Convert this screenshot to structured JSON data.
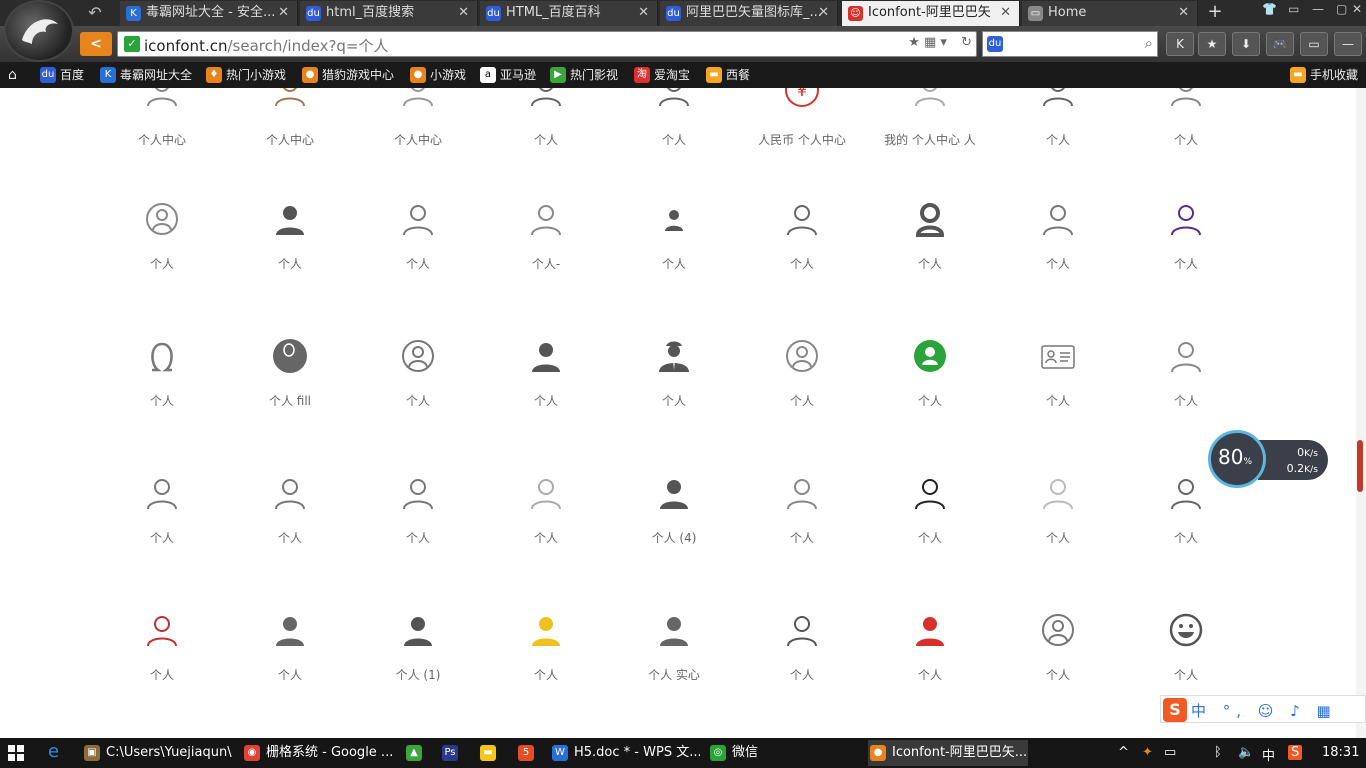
{
  "tabs": [
    {
      "title": "毒霸网址大全 - 安全...",
      "icon": "K",
      "color": "#2a6fd6"
    },
    {
      "title": "html_百度搜索",
      "icon": "du",
      "color": "#2f5ed8"
    },
    {
      "title": "HTML_百度百科",
      "icon": "du",
      "color": "#2f5ed8"
    },
    {
      "title": "阿里巴巴矢量图标库_...",
      "icon": "du",
      "color": "#2f5ed8"
    },
    {
      "title": "Iconfont-阿里巴巴矢",
      "icon": "☺",
      "color": "#d8312b"
    },
    {
      "title": "Home",
      "icon": "▭",
      "color": "#888"
    }
  ],
  "address": {
    "host": "iconfont.cn",
    "path": "/search/index?q=个人"
  },
  "bookmarks": [
    {
      "label": "百度",
      "color": "#2f5ed8",
      "icon": "du"
    },
    {
      "label": "毒霸网址大全",
      "color": "#2a6fd6",
      "icon": "K"
    },
    {
      "label": "热门小游戏",
      "color": "#e8841c",
      "icon": "♦"
    },
    {
      "label": "猎豹游戏中心",
      "color": "#e8841c",
      "icon": "●"
    },
    {
      "label": "小游戏",
      "color": "#e8841c",
      "icon": "●"
    },
    {
      "label": "亚马逊",
      "color": "#fff",
      "icon": "a"
    },
    {
      "label": "热门影视",
      "color": "#3aa63a",
      "icon": "▶"
    },
    {
      "label": "爱淘宝",
      "color": "#e03030",
      "icon": "淘"
    },
    {
      "label": "西餐",
      "color": "#f5a623",
      "icon": "▬"
    }
  ],
  "bookmarks_right": "手机收藏",
  "icon_rows": [
    [
      "个人中心",
      "个人中心",
      "个人中心",
      "个人",
      "个人",
      "人民币 个人中心",
      "我的 个人中心 人",
      "个人",
      "个人"
    ],
    [
      "个人",
      "个人",
      "个人",
      "个人-",
      "个人",
      "个人",
      "个人",
      "个人",
      "个人"
    ],
    [
      "个人",
      "个人 fill",
      "个人",
      "个人",
      "个人",
      "个人",
      "个人",
      "个人",
      "个人"
    ],
    [
      "个人",
      "个人",
      "个人",
      "个人",
      "个人 (4)",
      "个人",
      "个人",
      "个人",
      "个人"
    ],
    [
      "个人",
      "个人",
      "个人 (1)",
      "个人",
      "个人 实心",
      "个人",
      "个人",
      "个人",
      "个人"
    ]
  ],
  "net": {
    "percent": "80",
    "up": "0",
    "down": "0.2",
    "unit": "K/s"
  },
  "ime": "中 °, ☺ ♪ ▦",
  "taskbar": [
    {
      "label": "C:\\Users\\Yuejiaqun\\...",
      "color": "#8a6d3b",
      "icon": "▣"
    },
    {
      "label": "栅格系统 - Google ...",
      "color": "#db4437",
      "icon": "◉"
    },
    {
      "label": "",
      "color": "#3aa63a",
      "icon": "▲"
    },
    {
      "label": "",
      "color": "#2b3a8a",
      "icon": "Ps"
    },
    {
      "label": "",
      "color": "#f5c518",
      "icon": "▬"
    },
    {
      "label": "",
      "color": "#e44d26",
      "icon": "5"
    },
    {
      "label": "H5.doc * - WPS 文...",
      "color": "#2a6fd6",
      "icon": "W"
    },
    {
      "label": "微信",
      "color": "#2aa33a",
      "icon": "◎"
    },
    {
      "label": "Iconfont-阿里巴巴矢...",
      "color": "#e8841c",
      "icon": "●"
    }
  ],
  "tray": {
    "lang": "中",
    "time": "18:31"
  }
}
